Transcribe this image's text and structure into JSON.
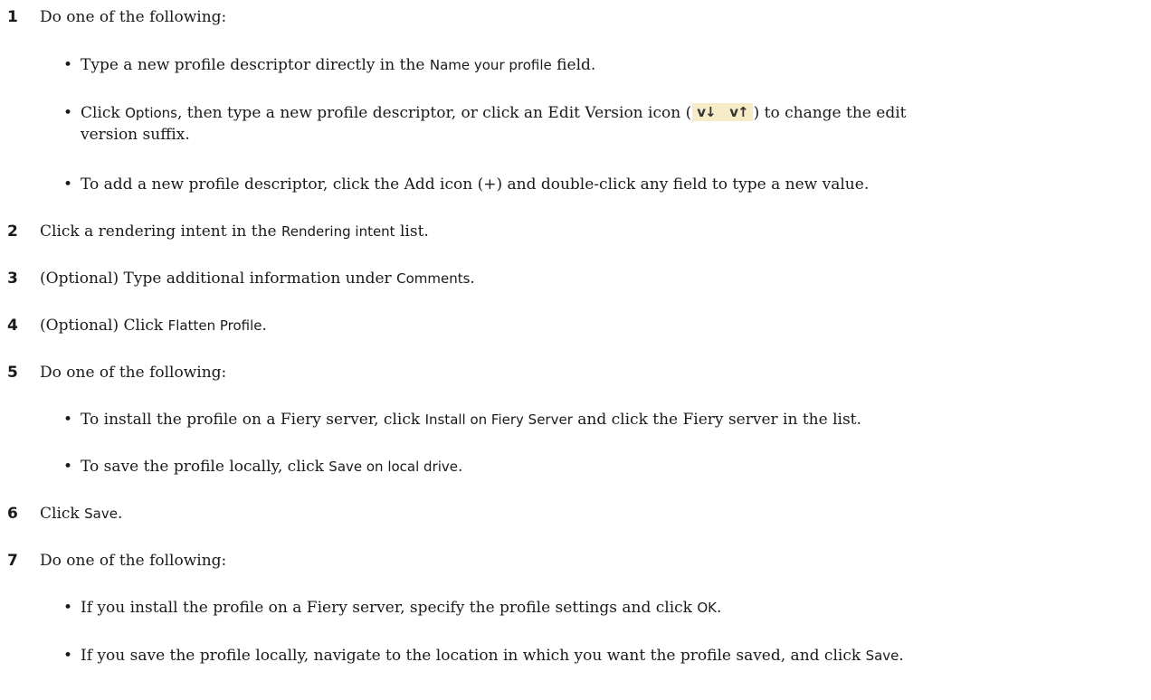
{
  "steps": [
    {
      "num": "1",
      "text": "Do one of the following:"
    },
    {
      "num": "2",
      "pre": "Click a rendering intent in the ",
      "ui": "Rendering intent",
      "post": " list."
    },
    {
      "num": "3",
      "pre": "(Optional) Type additional information under ",
      "ui": "Comments",
      "post": "."
    },
    {
      "num": "4",
      "pre": "(Optional) Click ",
      "ui": "Flatten Profile",
      "post": "."
    },
    {
      "num": "5",
      "text": "Do one of the following:"
    },
    {
      "num": "6",
      "pre": "Click ",
      "ui": "Save",
      "post": "."
    },
    {
      "num": "7",
      "text": "Do one of the following:"
    }
  ],
  "bullets": {
    "b1": {
      "pre": "Type a new profile descriptor directly in the ",
      "ui": "Name your profile",
      "post": " field."
    },
    "b2": {
      "pre": "Click ",
      "ui": "Options",
      "mid": ", then type a new profile descriptor, or click an Edit Version icon (",
      "icon1": "v↓",
      "icon2": "v↑",
      "post": ") to change the edit",
      "line2": "version suffix."
    },
    "b3": {
      "text": "To add a new profile descriptor, click the Add icon (+) and double-click any field to type a new value."
    },
    "b4": {
      "pre": "To install the profile on a Fiery server, click ",
      "ui": "Install on Fiery Server",
      "post": " and click the Fiery server in the list."
    },
    "b5": {
      "pre": "To save the profile locally, click ",
      "ui": "Save on local drive",
      "post": "."
    },
    "b6": {
      "pre": "If you install the profile on a Fiery server, specify the profile settings and click ",
      "ui": "OK",
      "post": "."
    },
    "b7": {
      "pre": "If you save the profile locally, navigate to the location in which you want the profile saved, and click ",
      "ui": "Save",
      "post": "."
    }
  },
  "bullet_char": "•"
}
